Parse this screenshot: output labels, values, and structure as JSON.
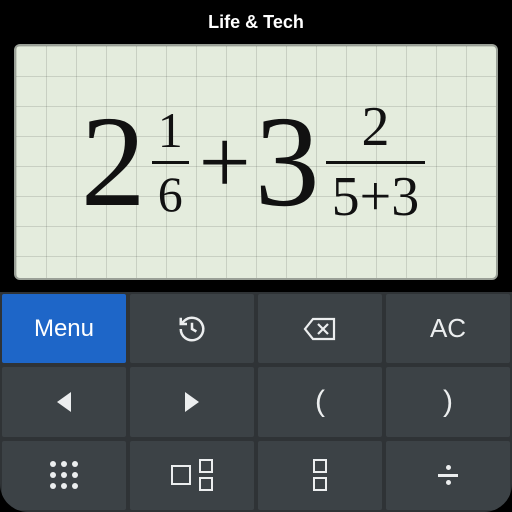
{
  "header": {
    "title": "Life & Tech"
  },
  "display": {
    "expression_text": "2 1/6 + 3 2/(5+3)",
    "terms": [
      {
        "whole": "2",
        "numerator": "1",
        "denominator": "6"
      },
      {
        "operator": "+"
      },
      {
        "whole": "3",
        "numerator": "2",
        "denominator": "5+3"
      }
    ]
  },
  "keypad": {
    "row1": {
      "menu": "Menu",
      "history": "history",
      "backspace": "backspace",
      "ac": "AC"
    },
    "row2": {
      "left": "◀",
      "right": "▶",
      "lparen": "(",
      "rparen": ")"
    },
    "row3": {
      "apps": "apps-grid",
      "fraction": "fraction",
      "mixed": "mixed-fraction",
      "divide": "÷"
    }
  },
  "colors": {
    "menu_bg": "#1e66c8",
    "key_bg": "#3c4246",
    "display_bg": "#e4ecdd"
  }
}
